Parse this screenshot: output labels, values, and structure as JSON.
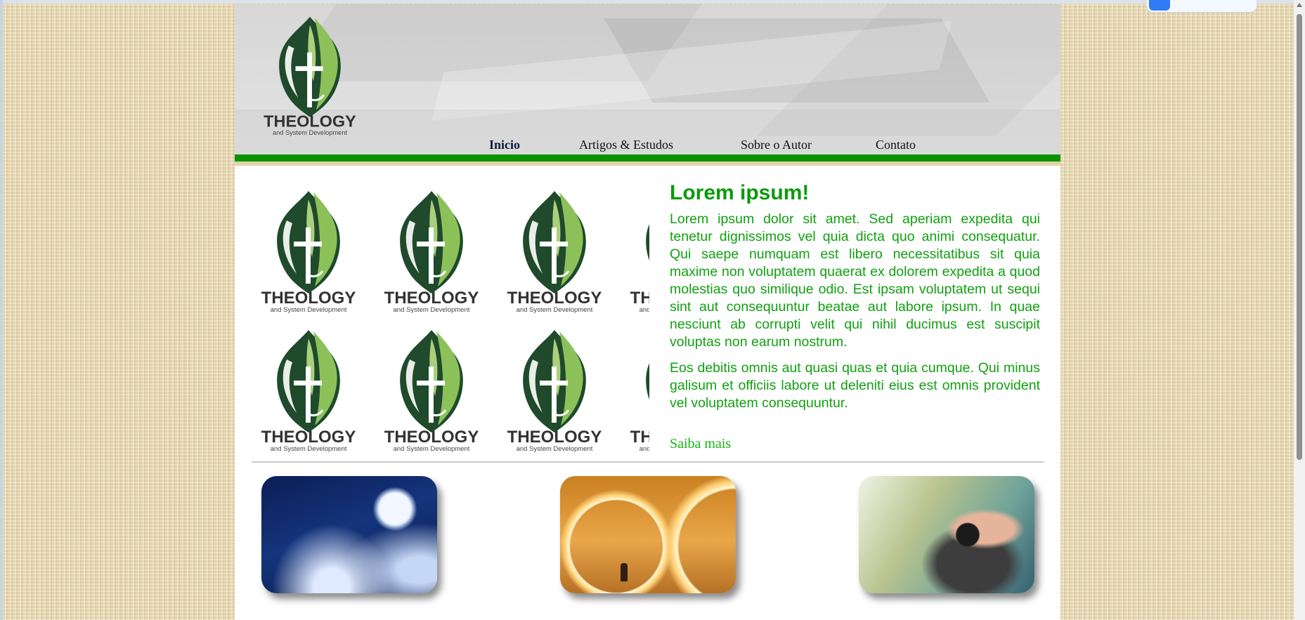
{
  "logo": {
    "brand": "THEOLOGY",
    "tagline": "and System Development"
  },
  "nav": {
    "items": [
      {
        "label": "Inicio",
        "active": true
      },
      {
        "label": "Artigos & Estudos",
        "active": false
      },
      {
        "label": "Sobre o Autor",
        "active": false
      },
      {
        "label": "Contato",
        "active": false
      }
    ]
  },
  "main": {
    "title": "Lorem ipsum!",
    "paragraph1": "Lorem ipsum dolor sit amet. Sed aperiam expedita qui tenetur dignissimos vel quia dicta quo animi consequatur. Qui saepe numquam est libero necessitatibus sit quia maxime non voluptatem quaerat ex dolorem expedita a quod molestias quo similique odio. Est ipsam voluptatem ut sequi sint aut consequuntur beatae aut labore ipsum. In quae nesciunt ab corrupti velit qui nihil ducimus est suscipit voluptas non earum nostrum.",
    "paragraph2": "Eos debitis omnis aut quasi quas et quia cumque. Qui minus galisum et officiis labore ut deleniti eius est omnis provident vel voluptatem consequuntur.",
    "more_link": "Saiba mais"
  },
  "colors": {
    "accent_green": "#0a9300",
    "text_green": "#11a011",
    "logo_dark_green": "#1f4a2b",
    "logo_light_green": "#8cc15a"
  },
  "gallery": [
    {
      "image": "moon-clouds-image"
    },
    {
      "image": "golden-rings-image"
    },
    {
      "image": "photographer-image"
    }
  ]
}
